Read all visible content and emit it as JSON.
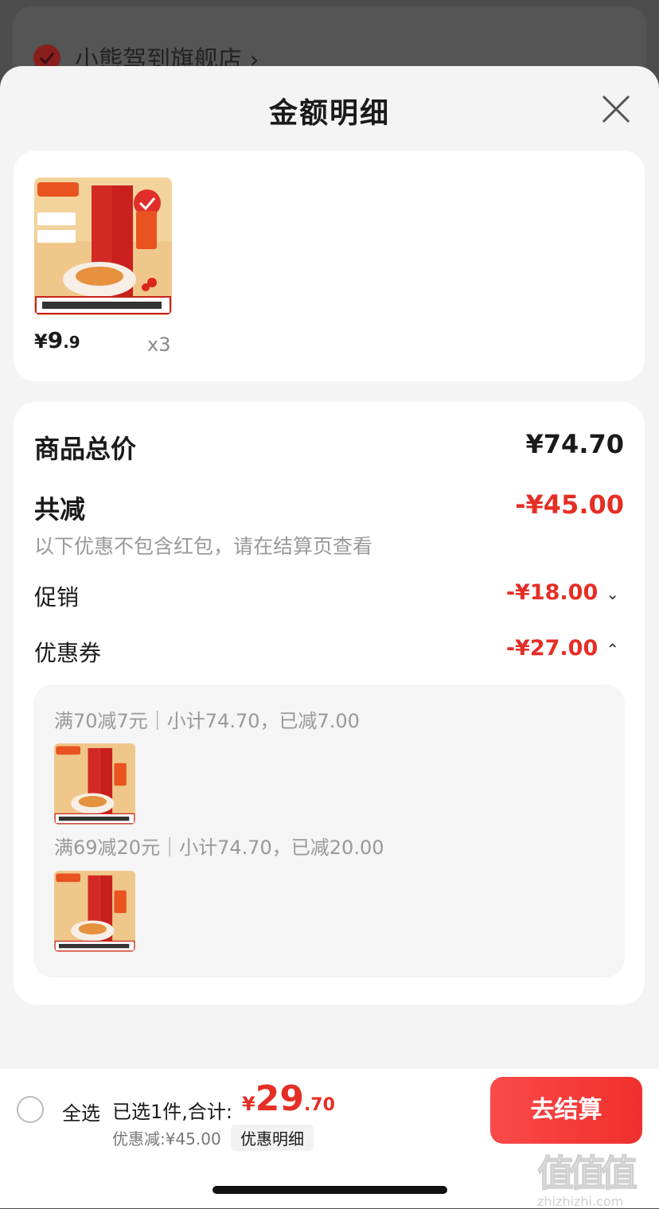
{
  "background": {
    "store_name": "小熊驾到旗舰店 ›"
  },
  "sheet": {
    "title": "金额明细"
  },
  "item": {
    "image_icon": "product-image-tomato-pasta-sauce",
    "price_symbol": "¥",
    "price_int": "9",
    "price_dec": ".9",
    "quantity": "x3"
  },
  "detail": {
    "goods_total_label": "商品总价",
    "goods_total_value": "¥74.70",
    "total_reduce_label": "共减",
    "total_reduce_value": "-¥45.00",
    "note": "以下优惠不包含红包，请在结算页查看",
    "promo_label": "促销",
    "promo_value": "-¥18.00",
    "coupon_label": "优惠券",
    "coupon_value": "-¥27.00",
    "coupons": [
      {
        "text": "满70减7元｜小计74.70，已减7.00"
      },
      {
        "text": "满69减20元｜小计74.70，已减20.00"
      }
    ]
  },
  "bottom": {
    "select_all": "全选",
    "summary": "已选1件,合计:",
    "total_symbol": "¥",
    "total_int": "29",
    "total_dec": ".70",
    "discount": "优惠减:¥45.00",
    "detail_button": "优惠明细",
    "checkout_button": "去结算",
    "watermark": "值值值",
    "watermark_url": "zhizhizhi.com"
  },
  "colors": {
    "accent_red": "#e52e25",
    "checkout_red": "#f0302d"
  }
}
